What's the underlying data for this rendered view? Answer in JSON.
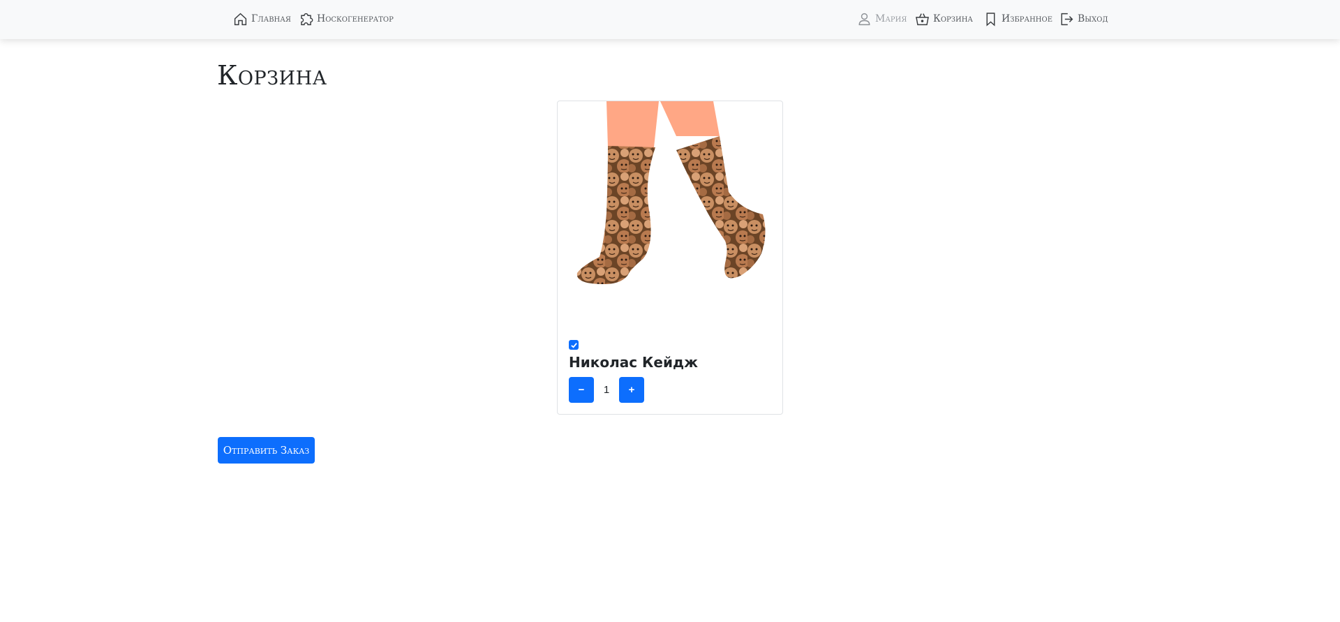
{
  "nav": {
    "home_label": "Главная",
    "generator_label": "Носкогенератор",
    "user_label": "Мария",
    "cart_label": "Корзина",
    "favorites_label": "Избранное",
    "logout_label": "Выход"
  },
  "page": {
    "title": "Корзина"
  },
  "cart": {
    "items": [
      {
        "name": "Николас Кейдж",
        "selected": true,
        "quantity": "1",
        "minus_label": "−",
        "plus_label": "+",
        "image": "socks-with-face-pattern"
      }
    ]
  },
  "actions": {
    "submit_label": "Отправить Заказ"
  },
  "colors": {
    "primary": "#0d6efd",
    "navbar_bg": "#f8f9fa",
    "nav_text": "#55595e",
    "nav_text_muted": "#9a9ea3"
  }
}
